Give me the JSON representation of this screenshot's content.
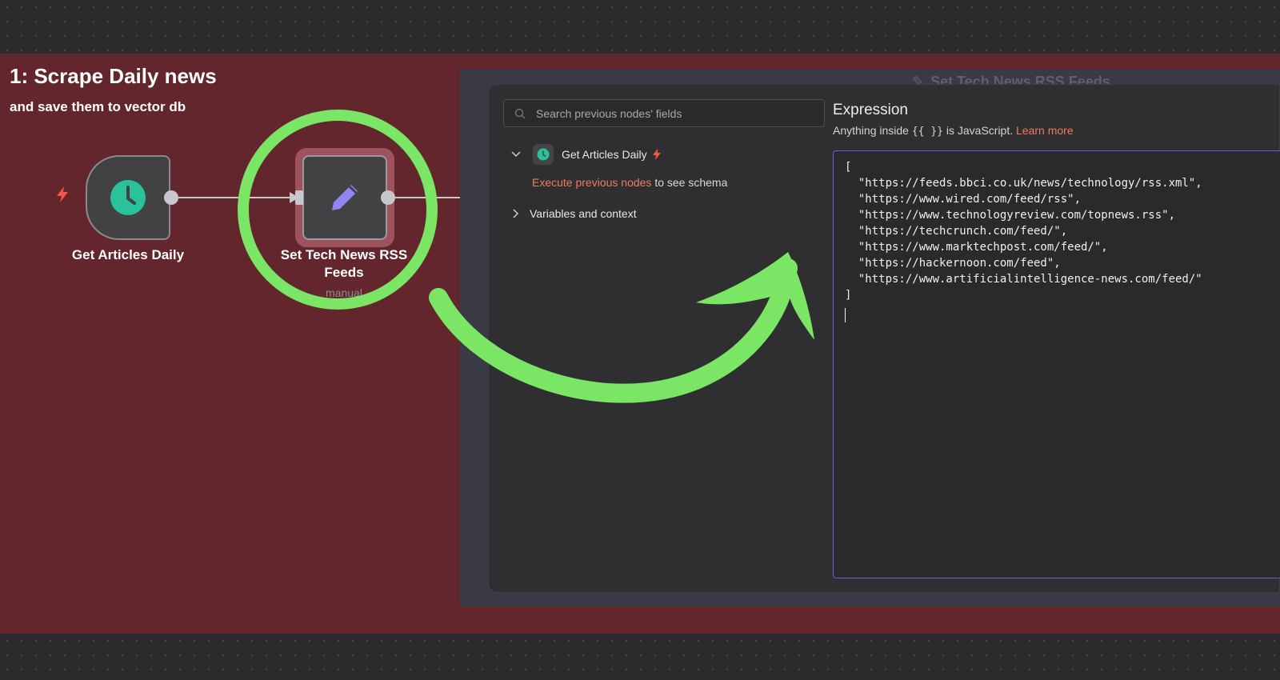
{
  "sticky_note": {
    "title": "1: Scrape Daily news",
    "subtitle": "and save them to vector db",
    "color": "#62262c"
  },
  "workflow": {
    "nodes": [
      {
        "name": "Get Articles Daily",
        "icon": "clock-icon",
        "icon_color": "#29c29a"
      },
      {
        "name": "Set Tech News RSS Feeds",
        "subtitle": "manual",
        "icon": "pencil-icon",
        "icon_color": "#8e86f2"
      }
    ],
    "trigger_icon": "lightning-bolt-icon"
  },
  "background_panel": {
    "title": "Set Tech News RSS Feeds"
  },
  "expression_dialog": {
    "search": {
      "placeholder": "Search previous nodes' fields"
    },
    "tree": {
      "node_label": "Get Articles Daily",
      "execute_link": "Execute previous nodes",
      "execute_rest": " to see schema",
      "variables_label": "Variables and context"
    },
    "title": "Expression",
    "hint_prefix": "Anything inside ",
    "hint_code": "{{ }}",
    "hint_middle": " is JavaScript. ",
    "learn_more": "Learn more",
    "code_lines": [
      "[",
      "  \"https://feeds.bbci.co.uk/news/technology/rss.xml\",",
      "  \"https://www.wired.com/feed/rss\",",
      "  \"https://www.technologyreview.com/topnews.rss\",",
      "  \"https://techcrunch.com/feed/\",",
      "  \"https://www.marktechpost.com/feed/\",",
      "  \"https://hackernoon.com/feed\",",
      "  \"https://www.artificialintelligence-news.com/feed/\"",
      "]"
    ]
  },
  "colors": {
    "accent_orange": "#f07a5f",
    "annotation_green": "#7be565",
    "editor_border": "#6a5fd0"
  }
}
